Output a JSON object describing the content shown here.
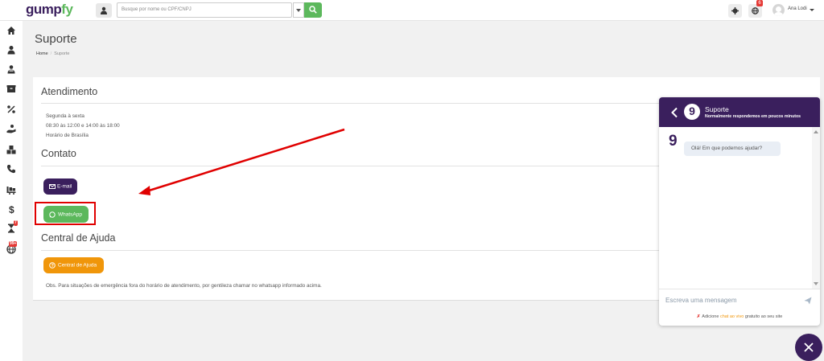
{
  "app": {
    "logo_main": "gump",
    "logo_accent": "fy",
    "search_placeholder": "Busque por nome ou CPF/CNPJ",
    "notification_count": "6",
    "user_name": "Ana Lodi"
  },
  "sidebar": {
    "icons": [
      "home-icon",
      "user-icon",
      "users-icon",
      "box-icon",
      "percent-icon",
      "hand-icon",
      "boxes-icon",
      "phone-icon",
      "truck-icon",
      "dollar-icon",
      "hourglass-icon",
      "globe-icon"
    ],
    "hourglass_badge": "7",
    "globe_badge": "99+"
  },
  "page": {
    "title": "Suporte",
    "breadcrumb_home": "Home",
    "breadcrumb_current": "Suporte"
  },
  "atendimento": {
    "title": "Atendimento",
    "days": "Segunda à sexta",
    "hours": "08:30 às 12:00 e 14:00 às 18:00",
    "timezone": "Horário de Brasília"
  },
  "contato": {
    "title": "Contato",
    "email_label": "E-mail",
    "whatsapp_label": "WhatsApp"
  },
  "ajuda": {
    "title": "Central de Ajuda",
    "button_label": "Central de Ajuda",
    "note": "Obs. Para situações de emergência fora do horário de atendimento, por gentileza chamar no whatsapp informado acima."
  },
  "chat": {
    "title": "Suporte",
    "subtitle": "Normalmente respondemos em poucos minutos",
    "logo_letter": "9",
    "message": "Olá! Em que podemos ajudar?",
    "input_placeholder": "Escreva uma mensagem",
    "footer_prefix": "Adicione",
    "footer_link": "chat ao vivo",
    "footer_suffix": "gratuito ao seu site"
  },
  "colors": {
    "brand_purple": "#3a1f5d",
    "whatsapp_green": "#5cb85c",
    "help_orange": "#f0960a",
    "highlight_red": "#e00000"
  }
}
